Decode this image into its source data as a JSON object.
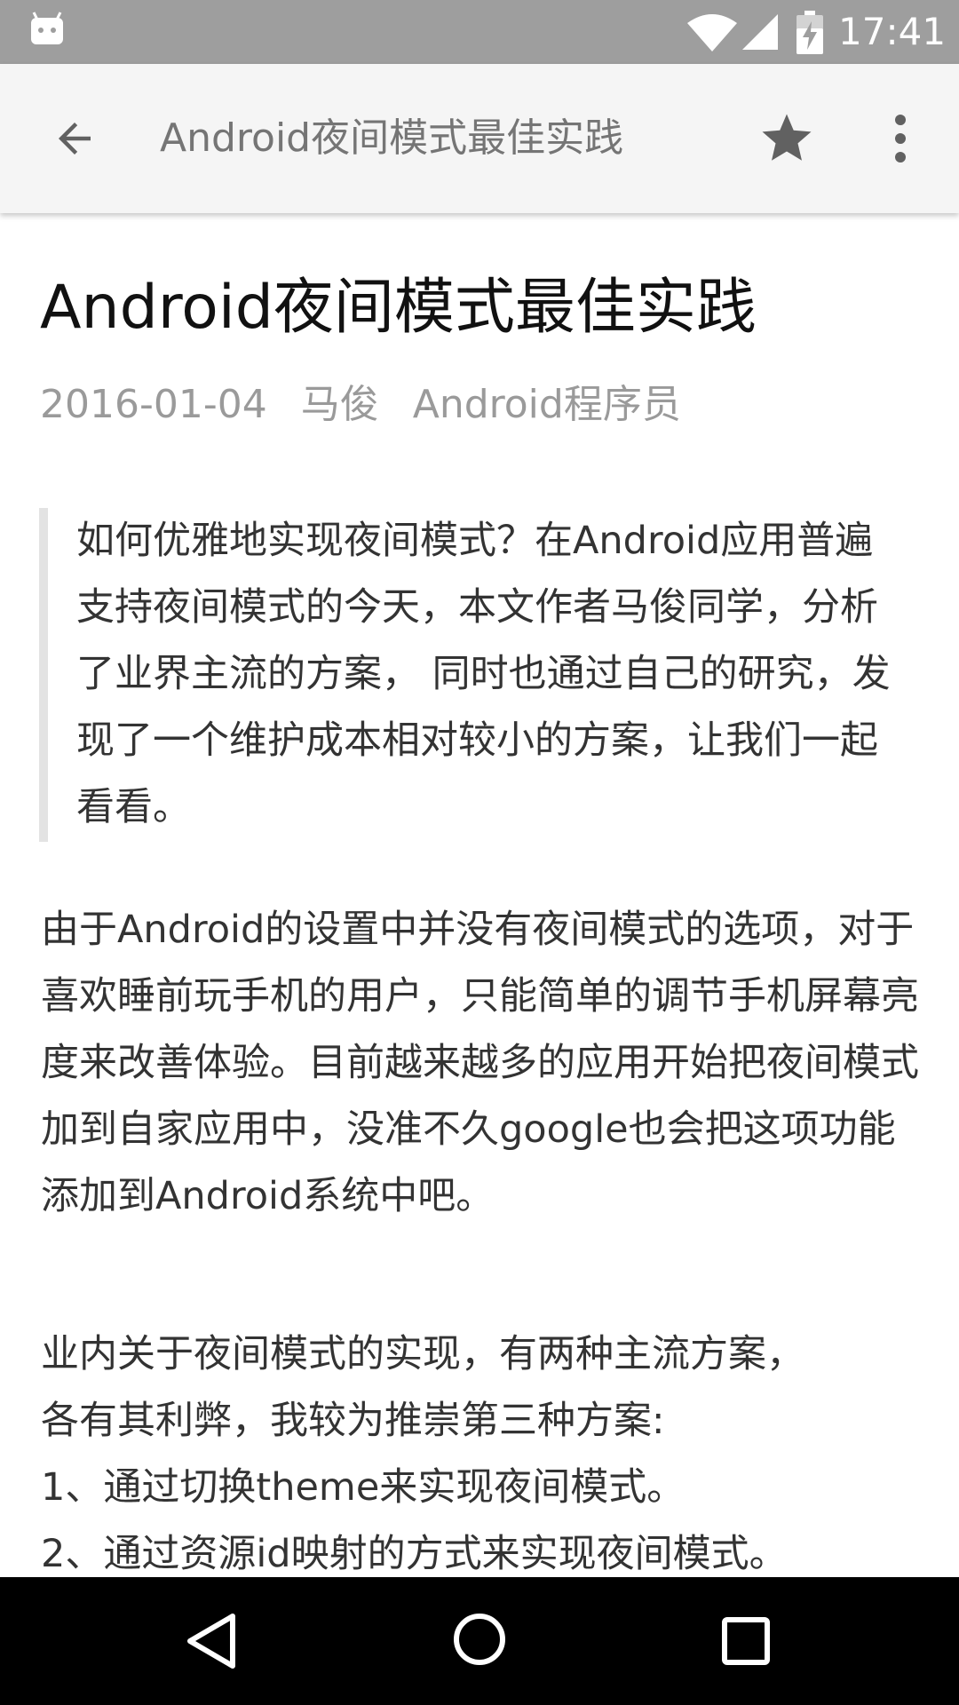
{
  "status_bar": {
    "time": "17:41",
    "icons": [
      "android-icon",
      "wifi-icon",
      "signal-icon",
      "battery-charging-icon"
    ]
  },
  "toolbar": {
    "title": "Android夜间模式最佳实践",
    "back_icon": "arrow-back-icon",
    "star_icon": "star-icon",
    "more_icon": "more-vert-icon"
  },
  "article": {
    "title": "Android夜间模式最佳实践",
    "date": "2016-01-04",
    "author": "马俊",
    "source": "Android程序员",
    "quote": "如何优雅地实现夜间模式？在Android应用普遍支持夜间模式的今天，本文作者马俊同学，分析了业界主流的方案， 同时也通过自己的研究，发现了一个维护成本相对较小的方案，让我们一起看看。",
    "paragraph1": "由于Android的设置中并没有夜间模式的选项，对于喜欢睡前玩手机的用户，只能简单的调节手机屏幕亮度来改善体验。目前越来越多的应用开始把夜间模式加到自家应用中，没准不久google也会把这项功能添加到Android系统中吧。",
    "paragraph2_lines": [
      "业内关于夜间模式的实现，有两种主流方案，",
      "各有其利弊，我较为推崇第三种方案:",
      "1、通过切换theme来实现夜间模式。",
      "2、通过资源id映射的方式来实现夜间模式。"
    ]
  },
  "nav_bar": {
    "icons": [
      "nav-back-icon",
      "nav-home-icon",
      "nav-recents-icon"
    ]
  },
  "colors": {
    "status_bar": "#9e9e9e",
    "toolbar": "#f5f5f5",
    "nav_bar": "#000000",
    "quote_bar": "#e3e3e3",
    "meta_text": "#9a9a9a"
  }
}
